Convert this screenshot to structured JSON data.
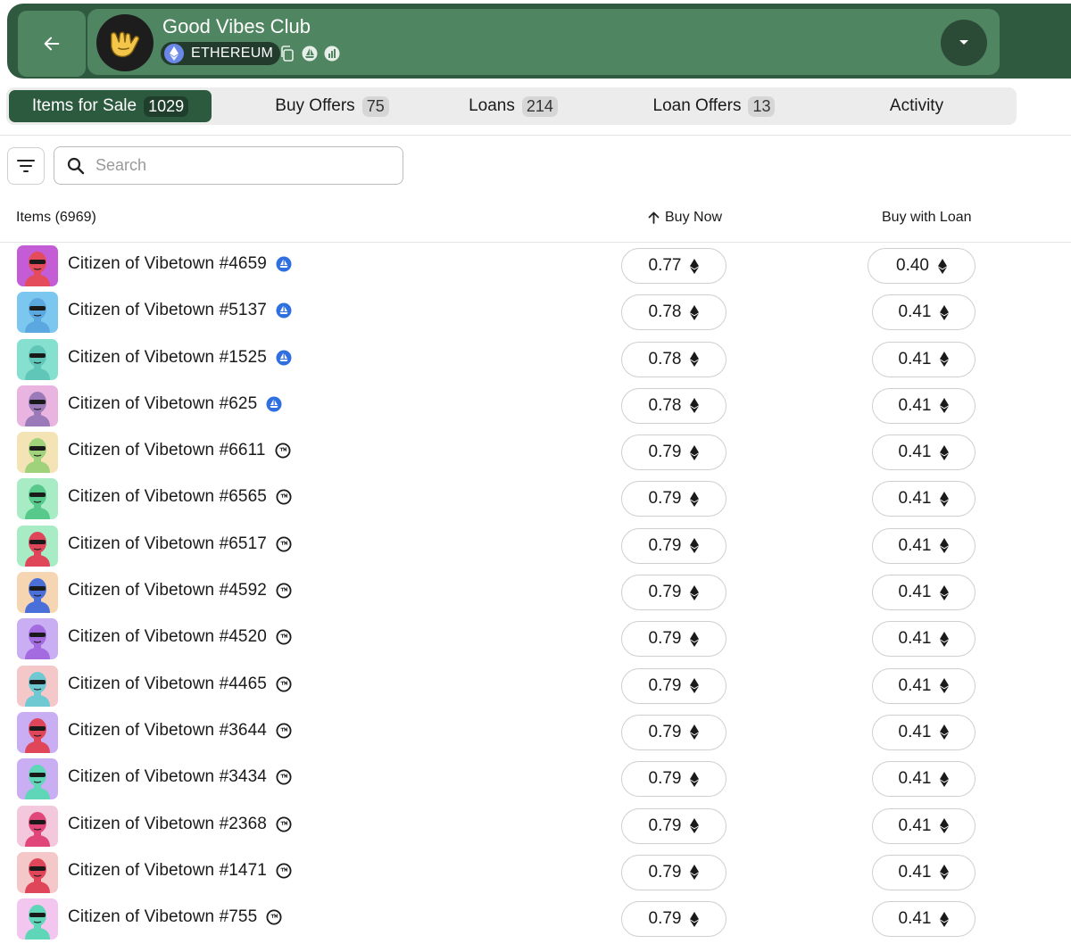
{
  "header": {
    "title": "Good Vibes Club",
    "chain": "ETHEREUM",
    "back_icon": "arrow-left-icon",
    "logo_icon": "shaka-hand-logo",
    "icons": [
      "copy-icon",
      "opensea-icon",
      "stats-icon"
    ],
    "dropdown_icon": "caret-down-icon",
    "colors": {
      "header_bg": "#2f5a3f",
      "panel_bg": "#4f8560",
      "active_tab": "#2c5a3f"
    }
  },
  "tabs": [
    {
      "label": "Items for Sale",
      "count": "1029",
      "active": true
    },
    {
      "label": "Buy Offers",
      "count": "75"
    },
    {
      "label": "Loans",
      "count": "214"
    },
    {
      "label": "Loan Offers",
      "count": "13"
    },
    {
      "label": "Activity",
      "count": ""
    }
  ],
  "search": {
    "placeholder": "Search",
    "value": ""
  },
  "table": {
    "col_items": "Items (6969)",
    "col_buy": "Buy Now",
    "col_loan": "Buy with Loan",
    "sort_icon": "arrow-up-icon",
    "rows": [
      {
        "name": "Citizen of Vibetown #4659",
        "buy": "0.77",
        "loan": "0.40",
        "market": "opensea",
        "avatar": [
          "#c45cd6",
          "#e44b5b"
        ]
      },
      {
        "name": "Citizen of Vibetown #5137",
        "buy": "0.78",
        "loan": "0.41",
        "market": "opensea",
        "avatar": [
          "#7cc7ef",
          "#5ba8e0"
        ]
      },
      {
        "name": "Citizen of Vibetown #1525",
        "buy": "0.78",
        "loan": "0.41",
        "market": "opensea",
        "avatar": [
          "#86e0d0",
          "#60c7b8"
        ]
      },
      {
        "name": "Citizen of Vibetown #625",
        "buy": "0.78",
        "loan": "0.41",
        "market": "opensea",
        "avatar": [
          "#e9b4e0",
          "#9a7ab8"
        ]
      },
      {
        "name": "Citizen of Vibetown #6611",
        "buy": "0.79",
        "loan": "0.41",
        "market": "other",
        "avatar": [
          "#f4e3b4",
          "#9fd27a"
        ]
      },
      {
        "name": "Citizen of Vibetown #6565",
        "buy": "0.79",
        "loan": "0.41",
        "market": "other",
        "avatar": [
          "#a8ecc5",
          "#56c98b"
        ]
      },
      {
        "name": "Citizen of Vibetown #6517",
        "buy": "0.79",
        "loan": "0.41",
        "market": "other",
        "avatar": [
          "#a8ecc5",
          "#e0465a"
        ]
      },
      {
        "name": "Citizen of Vibetown #4592",
        "buy": "0.79",
        "loan": "0.41",
        "market": "other",
        "avatar": [
          "#f6d5b3",
          "#4b6fd9"
        ]
      },
      {
        "name": "Citizen of Vibetown #4520",
        "buy": "0.79",
        "loan": "0.41",
        "market": "other",
        "avatar": [
          "#c9aef4",
          "#a46be0"
        ]
      },
      {
        "name": "Citizen of Vibetown #4465",
        "buy": "0.79",
        "loan": "0.41",
        "market": "other",
        "avatar": [
          "#f4c8c8",
          "#6ec9d3"
        ]
      },
      {
        "name": "Citizen of Vibetown #3644",
        "buy": "0.79",
        "loan": "0.41",
        "market": "other",
        "avatar": [
          "#c9aef4",
          "#e0465a"
        ]
      },
      {
        "name": "Citizen of Vibetown #3434",
        "buy": "0.79",
        "loan": "0.41",
        "market": "other",
        "avatar": [
          "#c9aef4",
          "#5fd6b8"
        ]
      },
      {
        "name": "Citizen of Vibetown #2368",
        "buy": "0.79",
        "loan": "0.41",
        "market": "other",
        "avatar": [
          "#f4c8dc",
          "#e0467a"
        ]
      },
      {
        "name": "Citizen of Vibetown #1471",
        "buy": "0.79",
        "loan": "0.41",
        "market": "other",
        "avatar": [
          "#f4c8c8",
          "#e0465a"
        ]
      },
      {
        "name": "Citizen of Vibetown #755",
        "buy": "0.79",
        "loan": "0.41",
        "market": "other",
        "avatar": [
          "#f2c6ef",
          "#5fd6b8"
        ]
      }
    ]
  }
}
